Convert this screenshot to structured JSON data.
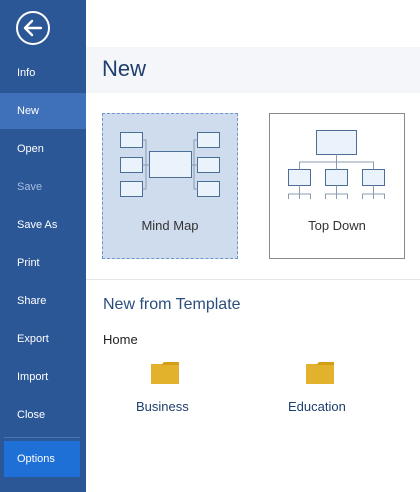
{
  "sidebar": {
    "items": [
      {
        "label": "Info"
      },
      {
        "label": "New"
      },
      {
        "label": "Open"
      },
      {
        "label": "Save"
      },
      {
        "label": "Save As"
      },
      {
        "label": "Print"
      },
      {
        "label": "Share"
      },
      {
        "label": "Export"
      },
      {
        "label": "Import"
      },
      {
        "label": "Close"
      },
      {
        "label": "Options"
      }
    ],
    "active": "New",
    "disabled": [
      "Save"
    ]
  },
  "main": {
    "title": "New",
    "templates": [
      {
        "label": "Mind Map",
        "icon": "mind-map-icon",
        "selected": true
      },
      {
        "label": "Top Down",
        "icon": "top-down-icon",
        "selected": false
      }
    ],
    "template_section": {
      "title": "New from Template",
      "breadcrumb": "Home",
      "folders": [
        {
          "label": "Business",
          "icon": "folder-icon"
        },
        {
          "label": "Education",
          "icon": "folder-icon"
        }
      ]
    }
  },
  "colors": {
    "sidebar_bg": "#2b5797",
    "sidebar_active": "#3f70ba",
    "options_bg": "#1e6fd6",
    "folder": "#e2b22c",
    "title": "#1e3f6f"
  }
}
